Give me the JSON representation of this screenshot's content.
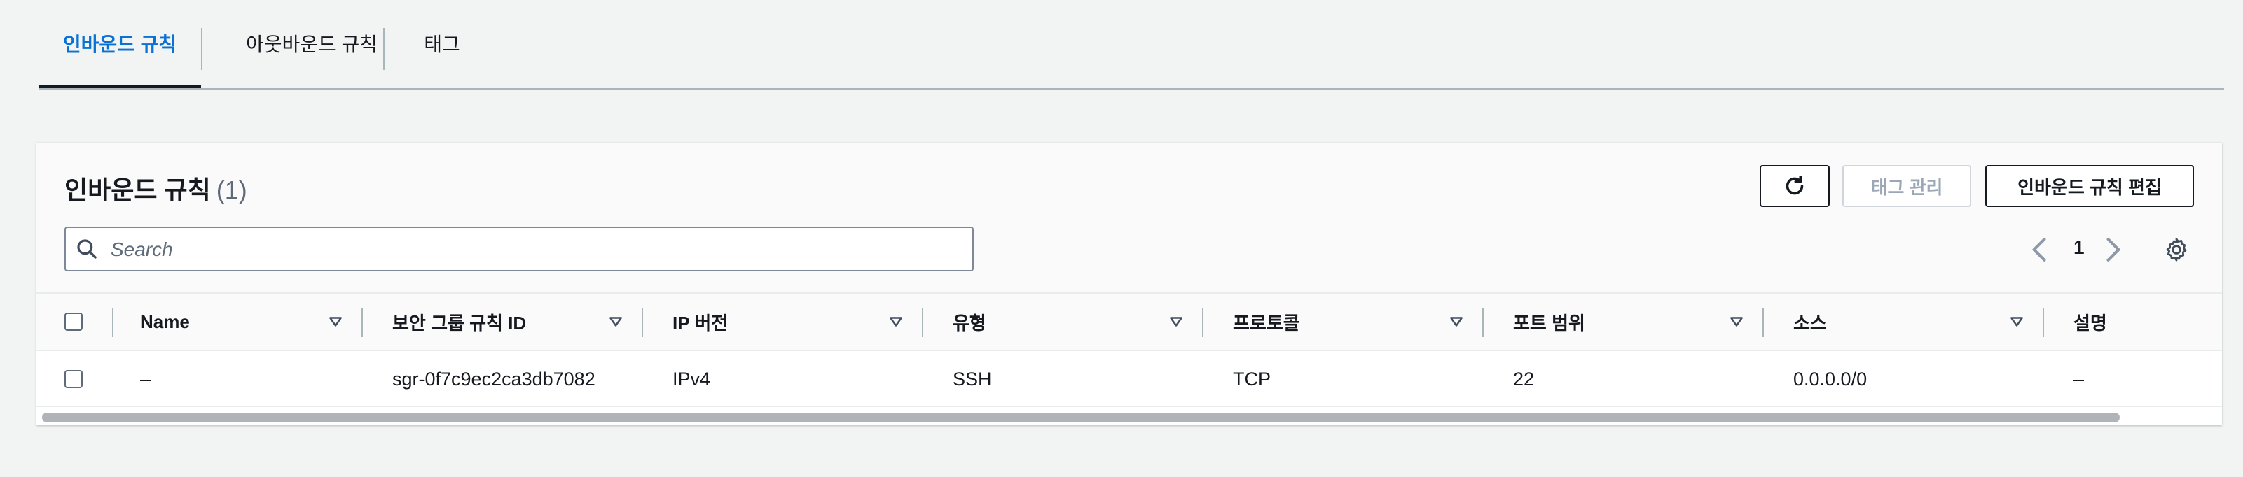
{
  "tabs": [
    {
      "label": "인바운드 규칙",
      "active": true
    },
    {
      "label": "아웃바운드 규칙",
      "active": false
    },
    {
      "label": "태그",
      "active": false
    }
  ],
  "panel": {
    "title": "인바운드 규칙",
    "count": "(1)",
    "buttons": {
      "refresh_icon": "refresh-icon",
      "manage_tags": "태그 관리",
      "edit_rules": "인바운드 규칙 편집"
    },
    "search": {
      "placeholder": "Search",
      "value": ""
    },
    "pagination": {
      "current_page": "1"
    }
  },
  "table": {
    "columns": [
      "Name",
      "보안 그룹 규칙 ID",
      "IP 버전",
      "유형",
      "프로토콜",
      "포트 범위",
      "소스",
      "설명"
    ],
    "rows": [
      [
        "–",
        "sgr-0f7c9ec2ca3db7082",
        "IPv4",
        "SSH",
        "TCP",
        "22",
        "0.0.0.0/0",
        "–"
      ]
    ]
  },
  "colors": {
    "active_tab": "#0972d3",
    "text": "#16191f",
    "disabled": "#9ba7b6",
    "border": "#aab7b8"
  }
}
